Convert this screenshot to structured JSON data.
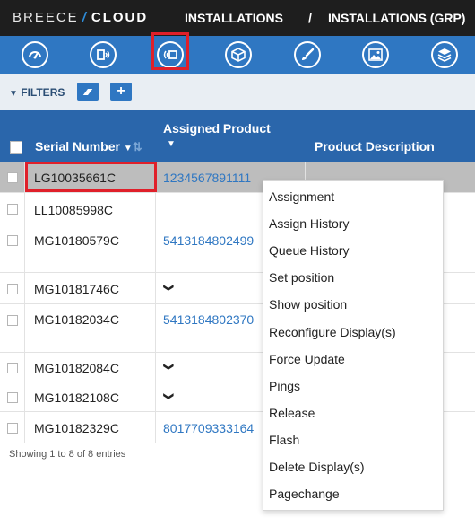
{
  "header": {
    "brand_left": "BREECE",
    "brand_slash": "/",
    "brand_right": "CLOUD",
    "crumb1": "INSTALLATIONS",
    "crumb_sep": "/",
    "crumb2": "INSTALLATIONS (GRP)"
  },
  "toolbar_icons": [
    "dashboard-icon",
    "display-signal-icon",
    "wireless-display-icon",
    "box-icon",
    "brush-icon",
    "image-icon",
    "layers-icon"
  ],
  "filters": {
    "label": "FILTERS",
    "add_label": "+"
  },
  "table": {
    "columns": {
      "serial": "Serial Number",
      "product": "Assigned Product",
      "description": "Product Description"
    },
    "rows": [
      {
        "serial": "LG10035661C",
        "product": "1234567891111"
      },
      {
        "serial": "LL10085998C",
        "product": ""
      },
      {
        "serial": "MG10180579C",
        "product": "5413184802499"
      },
      {
        "serial": "MG10181746C",
        "product": ""
      },
      {
        "serial": "MG10182034C",
        "product": "5413184802370"
      },
      {
        "serial": "MG10182084C",
        "product": ""
      },
      {
        "serial": "MG10182108C",
        "product": ""
      },
      {
        "serial": "MG10182329C",
        "product": "8017709333164"
      }
    ],
    "footer": "Showing 1 to 8 of 8 entries"
  },
  "context_menu": {
    "items": [
      "Assignment",
      "Assign History",
      "Queue History",
      "Set position",
      "Show position",
      "Reconfigure Display(s)",
      "Force Update",
      "Pings",
      "Release",
      "Flash",
      "Delete Display(s)",
      "Pagechange"
    ]
  },
  "colors": {
    "header_bg": "#1e1e1e",
    "toolbar_bg": "#2f77c2",
    "table_header_bg": "#2a66ab",
    "highlight": "#e0202a",
    "link": "#2f77c2"
  }
}
